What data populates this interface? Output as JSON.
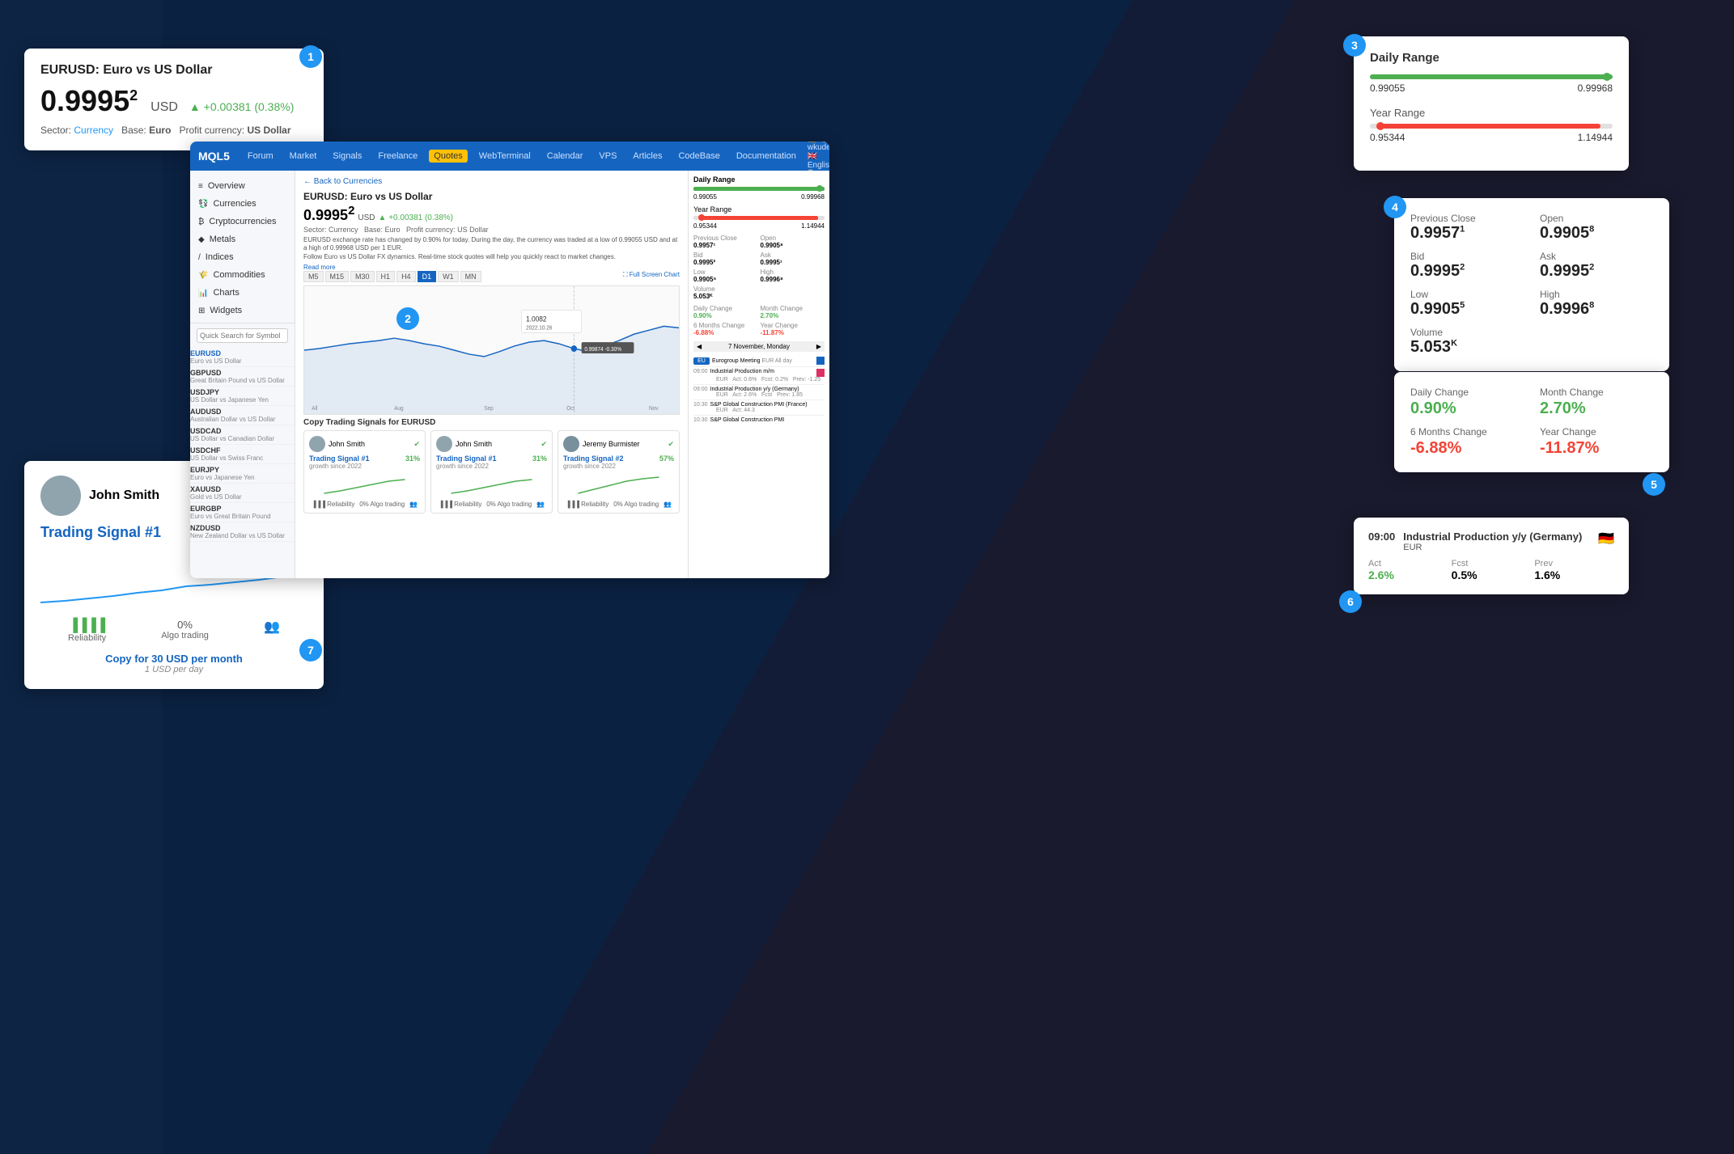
{
  "background": {
    "color1": "#0d2444",
    "color2": "#1a3a6b"
  },
  "badge_color": "#2196F3",
  "card1": {
    "title": "EURUSD: Euro vs US Dollar",
    "price": "0.9995",
    "price_sup": "2",
    "currency": "USD",
    "change": "+0.00381 (0.38%)",
    "sector_label": "Sector:",
    "sector_link": "Currency",
    "base_label": "Base:",
    "base_val": "Euro",
    "profit_label": "Profit currency:",
    "profit_val": "US Dollar",
    "badge": "1"
  },
  "card3": {
    "title": "Daily Range",
    "daily_low": "0.99055",
    "daily_high": "0.99968",
    "year_label": "Year Range",
    "year_low": "0.95344",
    "year_high": "1.14944",
    "badge": "3"
  },
  "card4": {
    "badge": "4",
    "prev_close_label": "Previous Close",
    "prev_close_val": "0.9957",
    "prev_close_sup": "1",
    "open_label": "Open",
    "open_val": "0.9905",
    "open_sup": "8",
    "bid_label": "Bid",
    "bid_val": "0.9995",
    "bid_sup": "2",
    "ask_label": "Ask",
    "ask_val": "0.9995",
    "ask_sup": "2",
    "low_label": "Low",
    "low_val": "0.9905",
    "low_sup": "5",
    "high_label": "High",
    "high_val": "0.9996",
    "high_sup": "8",
    "volume_label": "Volume",
    "volume_val": "5.053",
    "volume_sup": "K"
  },
  "card5": {
    "badge": "5",
    "daily_change_label": "Daily Change",
    "daily_change_val": "0.90%",
    "month_change_label": "Month Change",
    "month_change_val": "2.70%",
    "six_months_label": "6 Months Change",
    "six_months_val": "-6.88%",
    "year_change_label": "Year Change",
    "year_change_val": "-11.87%"
  },
  "card6": {
    "badge": "6",
    "time": "09:00",
    "title": "Industrial Production y/y (Germany)",
    "currency": "EUR",
    "act_label": "Act",
    "act_val": "2.6%",
    "fcst_label": "Fcst",
    "fcst_val": "0.5%",
    "prev_label": "Prev",
    "prev_val": "1.6%"
  },
  "card7": {
    "badge": "7",
    "user_name": "John Smith",
    "signal_title": "Trading Signal #1",
    "growth": "31%",
    "since": "growth since 2022",
    "reliability_label": "Reliability",
    "algo_label": "Algo trading",
    "algo_val": "0%",
    "copy_btn": "Copy for 30 USD per month",
    "per_day": "1 USD per day"
  },
  "platform": {
    "logo": "MQL5",
    "nav": [
      "Forum",
      "Market",
      "Signals",
      "Freelance",
      "Quotes",
      "WebTerminal",
      "Calendar",
      "VPS",
      "Articles",
      "CodeBase",
      "Documentation"
    ],
    "active_nav": "Quotes",
    "sidebar_items": [
      {
        "label": "Overview",
        "icon": "≡"
      },
      {
        "label": "Currencies",
        "icon": "💱"
      },
      {
        "label": "Cryptocurrencies",
        "icon": "₿"
      },
      {
        "label": "Metals",
        "icon": "◆"
      },
      {
        "label": "Indices",
        "icon": "/"
      },
      {
        "label": "Commodities",
        "icon": "🌾"
      },
      {
        "label": "Charts",
        "icon": "📊"
      },
      {
        "label": "Widgets",
        "icon": "⊞"
      }
    ],
    "search_placeholder": "Quick Search for Symbol",
    "symbol_list": [
      {
        "name": "EURUSD",
        "desc": "Euro vs US Dollar",
        "active": true
      },
      {
        "name": "GBPUSD",
        "desc": "Great Britain Pound vs US Dollar"
      },
      {
        "name": "USDJPY",
        "desc": "US Dollar vs Japanese Yen"
      },
      {
        "name": "AUDUSD",
        "desc": "Australian Dollar vs US Dollar"
      },
      {
        "name": "USDCAD",
        "desc": "US Dollar vs Canadian Dollar"
      },
      {
        "name": "USDCHF",
        "desc": "US Dollar vs Swiss Franc"
      },
      {
        "name": "EURJPY",
        "desc": "Euro vs Japanese Yen"
      },
      {
        "name": "XAUUSD",
        "desc": "Gold vs US Dollar"
      },
      {
        "name": "EURGBP",
        "desc": "Euro vs Great Britain Pound"
      },
      {
        "name": "NZDUSD",
        "desc": "New Zealand Dollar vs US Dollar"
      }
    ],
    "main": {
      "back_link": "← Back to Currencies",
      "symbol": "EURUSD: Euro vs US Dollar",
      "price": "0.9995",
      "price_sup": "2",
      "currency": "USD",
      "change": "+0.00381 (0.38%)",
      "meta": "Sector: Currency   Base: Euro   Profit currency: US Dollar",
      "timeframes": [
        "M5",
        "M15",
        "M30",
        "H1",
        "H4",
        "D1",
        "W1",
        "MN"
      ],
      "active_tf": "D1",
      "chart_tooltip": "1.0082",
      "chart_date": "2022.10.26",
      "price_at_cursor": "0.99874 -0.30%",
      "fullscreen_btn": "Full Screen Chart",
      "signals_title": "Copy Trading Signals for EURUSD",
      "signals": [
        {
          "user": "John Smith",
          "title": "Trading Signal #1",
          "growth": "31%",
          "since": "growth since 2022"
        },
        {
          "user": "John Smith",
          "title": "Trading Signal #1",
          "growth": "31%",
          "since": "growth since 2022"
        },
        {
          "user": "Jeremy Burmister",
          "title": "Trading Signal #2",
          "growth": "57%",
          "since": "growth since 2022"
        }
      ]
    },
    "right_panel": {
      "daily_range_label": "Daily Range",
      "daily_low": "0.99055",
      "daily_high": "0.99968",
      "year_range_label": "Year Range",
      "year_low": "0.95344",
      "year_high": "1.14944",
      "prev_close": "0.9957¹",
      "open": "0.9905⁸",
      "bid": "0.9995²",
      "ask": "0.9995¹",
      "low": "0.9905⁵",
      "high": "0.9996⁸",
      "volume": "5.053ᴷ",
      "daily_change": "0.90%",
      "month_change": "2.70%",
      "six_months": "-6.88%",
      "year_change": "-11.87%",
      "calendar_date": "7 November, Monday",
      "events": [
        {
          "name": "Eurogroup Meeting",
          "currency": "EUR",
          "time": "All day"
        },
        {
          "name": "Industrial Production m/m",
          "currency": "EUR",
          "time": "09:00",
          "act": "0.6%",
          "fcst": "0.2%",
          "prev": "-1.25"
        },
        {
          "name": "Industrial Production y/y (Germany)",
          "currency": "EUR",
          "time": "09:00",
          "act": "2.6%",
          "fcst": "Fcst",
          "prev": "1.85"
        },
        {
          "name": "S&P Global Construction PMI (France)",
          "currency": "EUR",
          "time": "10:30",
          "act": "44.3"
        },
        {
          "name": "S&P Global Construction PMI",
          "currency": "",
          "time": "10:30"
        }
      ]
    }
  }
}
